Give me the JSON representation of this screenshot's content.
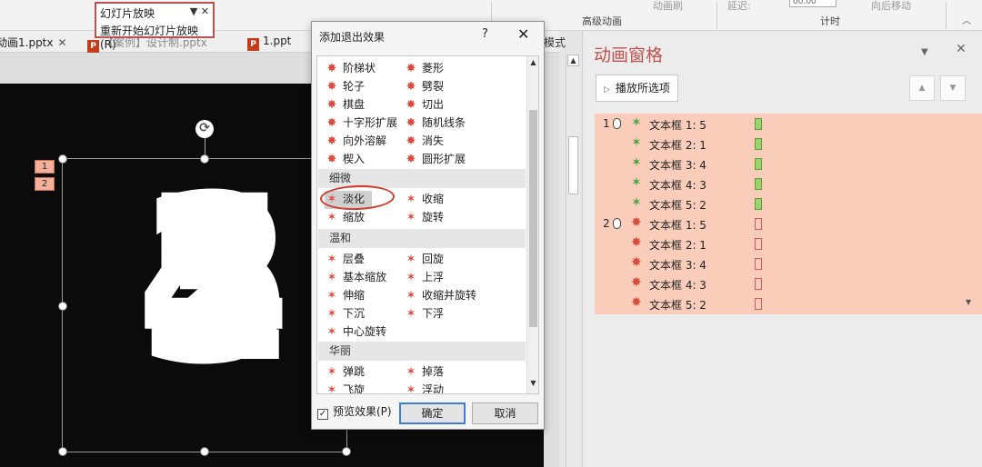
{
  "ribbon": {
    "advanced_animation_label": "高级动画",
    "timing_label": "计时",
    "faded_left": "动画刷",
    "faded_delay": "延迟:",
    "faded_delay_value": "00.00",
    "faded_right": "向后移动"
  },
  "slideshow_popup": {
    "title": "幻灯片放映",
    "restart": "重新开始幻灯片放映(R)"
  },
  "tabs": [
    {
      "label": "动画1.pptx"
    },
    {
      "label": "【案例】设计制.pptx"
    },
    {
      "label": "1.ppt"
    }
  ],
  "mode_label": "模式",
  "slide": {
    "tag1": "1",
    "tag2": "2",
    "digits": [
      "1",
      "2",
      "3",
      "4",
      "5"
    ]
  },
  "dialog": {
    "title": "添加退出效果",
    "help": "?",
    "close": "✕",
    "categories": {
      "basic_items": [
        [
          "阶梯状",
          "菱形"
        ],
        [
          "轮子",
          "劈裂"
        ],
        [
          "棋盘",
          "切出"
        ],
        [
          "十字形扩展",
          "随机线条"
        ],
        [
          "向外溶解",
          "消失"
        ],
        [
          "楔入",
          "圆形扩展"
        ]
      ],
      "subtle": "细微",
      "subtle_items": [
        [
          "淡化",
          "收缩"
        ],
        [
          "缩放",
          "旋转"
        ]
      ],
      "moderate": "温和",
      "moderate_items": [
        [
          "层叠",
          "回旋"
        ],
        [
          "基本缩放",
          "上浮"
        ],
        [
          "伸缩",
          "收缩并旋转"
        ],
        [
          "下沉",
          "下浮"
        ],
        [
          "中心旋转",
          ""
        ]
      ],
      "exciting": "华丽",
      "exciting_items": [
        [
          "弹跳",
          "掉落"
        ],
        [
          "飞旋",
          "浮动"
        ]
      ]
    },
    "selected": "淡化",
    "preview_label": "预览效果(P)",
    "preview_checked": true,
    "ok_label": "确定",
    "cancel_label": "取消"
  },
  "anim_pane": {
    "title": "动画窗格",
    "play_label": "播放所选项",
    "entries": [
      {
        "num": "1",
        "label": "文本框 1: 5",
        "kind": "entrance"
      },
      {
        "num": "",
        "label": "文本框 2: 1",
        "kind": "entrance"
      },
      {
        "num": "",
        "label": "文本框 3: 4",
        "kind": "entrance"
      },
      {
        "num": "",
        "label": "文本框 4: 3",
        "kind": "entrance"
      },
      {
        "num": "",
        "label": "文本框 5: 2",
        "kind": "entrance"
      },
      {
        "num": "2",
        "label": "文本框 1: 5",
        "kind": "exit"
      },
      {
        "num": "",
        "label": "文本框 2: 1",
        "kind": "exit"
      },
      {
        "num": "",
        "label": "文本框 3: 4",
        "kind": "exit"
      },
      {
        "num": "",
        "label": "文本框 4: 3",
        "kind": "exit"
      },
      {
        "num": "",
        "label": "文本框 5: 2",
        "kind": "exit"
      }
    ]
  },
  "colors": {
    "accent": "#c0504d",
    "list_bg": "#f9cdb9",
    "entrance_green": "#9dd36a",
    "exit_red": "#d45a5a"
  }
}
